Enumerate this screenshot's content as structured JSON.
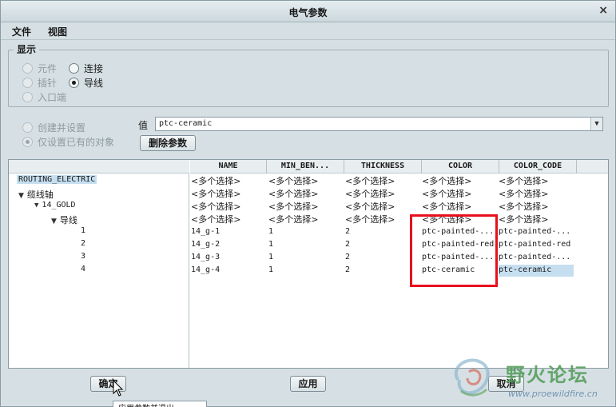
{
  "window": {
    "title": "电气参数",
    "close_glyph": "×"
  },
  "menu": {
    "file": "文件",
    "view": "视图"
  },
  "display_group": {
    "title": "显示",
    "options": [
      {
        "label": "元件",
        "checked": false,
        "enabled": false
      },
      {
        "label": "连接",
        "checked": false,
        "enabled": true
      },
      {
        "label": "插针",
        "checked": false,
        "enabled": false
      },
      {
        "label": "导线",
        "checked": true,
        "enabled": true
      },
      {
        "label": "入口端",
        "checked": false,
        "enabled": false
      }
    ]
  },
  "scope": {
    "create_and_set": "创建并设置",
    "only_existing": "仅设置已有的对象"
  },
  "value_field": {
    "label": "值",
    "value": "ptc-ceramic"
  },
  "delete_param_button": "删除参数",
  "tree": {
    "root": "ROUTING_ELECTRIC",
    "bundle": "缆线轴",
    "spool": "14_GOLD",
    "wires": "导线",
    "items": [
      "1",
      "2",
      "3",
      "4"
    ]
  },
  "columns": [
    "NAME",
    "MIN_BEN...",
    "THICKNESS",
    "COLOR",
    "COLOR_CODE"
  ],
  "multi_select": "<多个选择>",
  "rows": [
    {
      "name": "14_g-1",
      "min_ben": "1",
      "thickness": "2",
      "color": "ptc-painted-...",
      "color_code": "ptc-painted-..."
    },
    {
      "name": "14_g-2",
      "min_ben": "1",
      "thickness": "2",
      "color": "ptc-painted-red",
      "color_code": "ptc-painted-red"
    },
    {
      "name": "14_g-3",
      "min_ben": "1",
      "thickness": "2",
      "color": "ptc-painted-...",
      "color_code": "ptc-painted-..."
    },
    {
      "name": "14_g-4",
      "min_ben": "1",
      "thickness": "2",
      "color": "ptc-ceramic",
      "color_code": "ptc-ceramic"
    }
  ],
  "buttons": {
    "ok": "确定",
    "apply": "应用",
    "cancel": "取消"
  },
  "watermark": {
    "text": "野火论坛",
    "url": "www.proewildfire.cn"
  },
  "tooltip": "应用参数并退出",
  "colors": {
    "highlight": "#e8101c",
    "selection": "#c6dff0",
    "watermark": "#4f9a55"
  }
}
